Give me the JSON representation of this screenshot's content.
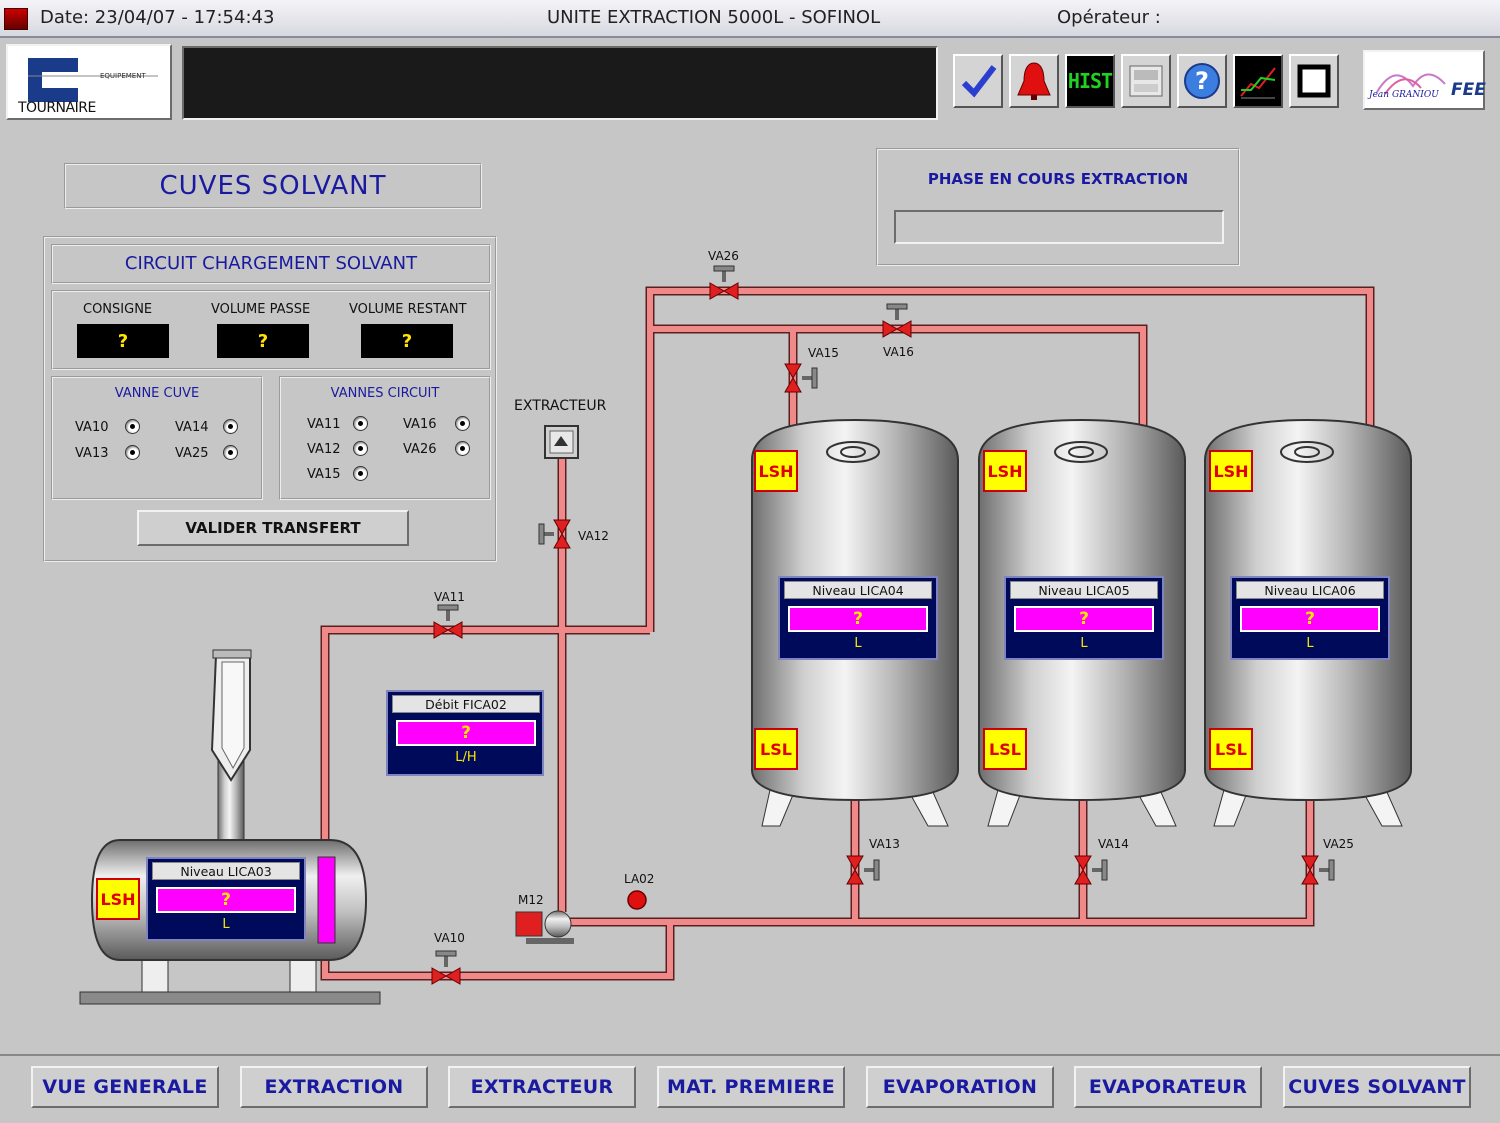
{
  "header": {
    "date": "Date: 23/04/07 - 17:54:43",
    "title": "UNITE EXTRACTION 5000L - SOFINOL",
    "operator": "Opérateur :"
  },
  "logos": {
    "left_brand": "TOURNAIRE",
    "left_sub": "EQUIPEMENT",
    "right_brand": "Jean GRANIOU",
    "right_sub": "FEE"
  },
  "toolbar": {
    "icons": [
      "check-icon",
      "alarm-bell-icon",
      "hist-icon",
      "printer-icon",
      "help-icon",
      "trend-chart-icon",
      "window-icon"
    ],
    "hist_label": "HIST"
  },
  "page_title": "CUVES SOLVANT",
  "phase": {
    "label": "PHASE EN COURS EXTRACTION",
    "value": ""
  },
  "circuit": {
    "title": "CIRCUIT CHARGEMENT SOLVANT",
    "consigne_label": "CONSIGNE",
    "consigne_value": "?",
    "passe_label": "VOLUME PASSE",
    "passe_value": "?",
    "restant_label": "VOLUME RESTANT",
    "restant_value": "?",
    "vanne_cuve": {
      "title": "VANNE CUVE",
      "items": [
        "VA10",
        "VA14",
        "VA13",
        "VA25"
      ]
    },
    "vannes_circuit": {
      "title": "VANNES CIRCUIT",
      "items": [
        "VA11",
        "VA16",
        "VA12",
        "VA26",
        "VA15"
      ]
    },
    "validate_label": "VALIDER TRANSFERT"
  },
  "extracteur_label": "EXTRACTEUR",
  "valves": [
    "VA26",
    "VA16",
    "VA15",
    "VA12",
    "VA11",
    "VA10",
    "VA13",
    "VA14",
    "VA25"
  ],
  "pump_label": "M12",
  "alarm_label": "LA02",
  "flow": {
    "name": "Débit FICA02",
    "value": "?",
    "unit": "L/H"
  },
  "tanks": [
    {
      "name": "Niveau LICA04",
      "value": "?",
      "unit": "L",
      "high": "LSH",
      "low": "LSL"
    },
    {
      "name": "Niveau LICA05",
      "value": "?",
      "unit": "L",
      "high": "LSH",
      "low": "LSL"
    },
    {
      "name": "Niveau LICA06",
      "value": "?",
      "unit": "L",
      "high": "LSH",
      "low": "LSL"
    }
  ],
  "horizontal_tank": {
    "name": "Niveau LICA03",
    "value": "?",
    "unit": "L",
    "high": "LSH"
  },
  "nav": [
    "VUE GENERALE",
    "EXTRACTION",
    "EXTRACTEUR",
    "MAT. PREMIERE",
    "EVAPORATION",
    "EVAPORATEUR",
    "CUVES SOLVANT"
  ],
  "colors": {
    "background": "#c6c6c6",
    "pipe": "#f08080",
    "accent": "#1a1aa0",
    "value_bg": "#ff00ff",
    "value_text": "#ffe600"
  }
}
